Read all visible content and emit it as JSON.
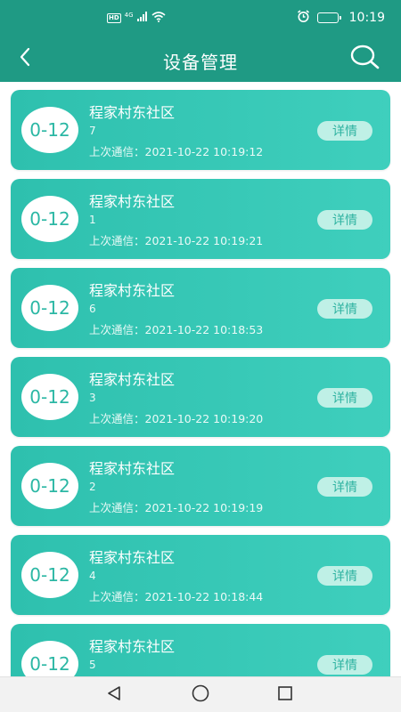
{
  "status_bar": {
    "network_badge": "HD",
    "network_type": "4G",
    "time": "10:19"
  },
  "header": {
    "title": "设备管理"
  },
  "devices": [
    {
      "age_range": "0-12",
      "name": "程家村东社区",
      "number": "7",
      "last_comm": "上次通信：2021-10-22 10:19:12",
      "detail_label": "详情"
    },
    {
      "age_range": "0-12",
      "name": "程家村东社区",
      "number": "1",
      "last_comm": "上次通信：2021-10-22 10:19:21",
      "detail_label": "详情"
    },
    {
      "age_range": "0-12",
      "name": "程家村东社区",
      "number": "6",
      "last_comm": "上次通信：2021-10-22 10:18:53",
      "detail_label": "详情"
    },
    {
      "age_range": "0-12",
      "name": "程家村东社区",
      "number": "3",
      "last_comm": "上次通信：2021-10-22 10:19:20",
      "detail_label": "详情"
    },
    {
      "age_range": "0-12",
      "name": "程家村东社区",
      "number": "2",
      "last_comm": "上次通信：2021-10-22 10:19:19",
      "detail_label": "详情"
    },
    {
      "age_range": "0-12",
      "name": "程家村东社区",
      "number": "4",
      "last_comm": "上次通信：2021-10-22 10:18:44",
      "detail_label": "详情"
    },
    {
      "age_range": "0-12",
      "name": "程家村东社区",
      "number": "5",
      "last_comm": "",
      "detail_label": "详情"
    }
  ],
  "icons": {
    "back": "chevron-left-icon",
    "search": "search-icon",
    "nav_back": "triangle-back-icon",
    "nav_home": "circle-home-icon",
    "nav_recents": "square-recents-icon"
  },
  "colors": {
    "header": "#1f9a84",
    "card": "#2ec0ae",
    "badge_text": "#2bb7a4",
    "detail_bg": "#bff0e6"
  }
}
